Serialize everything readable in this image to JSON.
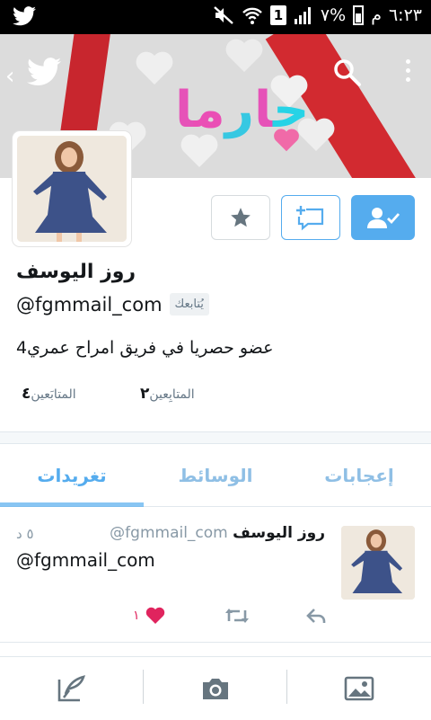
{
  "status_bar": {
    "time": "٦:٢٣",
    "period": "م",
    "battery": "٧%",
    "sim": "1"
  },
  "header": {
    "banner_text": [
      "ا",
      "م",
      "ر",
      "ا",
      "ح"
    ]
  },
  "profile": {
    "name": "روز اليوسف",
    "handle": "@fgmmail_com",
    "follows_you": "يُتابعك",
    "bio": "عضو حصريا في فريق امراح عمري4",
    "followers_label": "المتابَعين",
    "followers_count": "٤",
    "following_label": "المتابِعين",
    "following_count": "٢"
  },
  "tabs": {
    "tweets": "تغريدات",
    "media": "الوسائط",
    "likes": "إعجابات",
    "active": "tweets"
  },
  "tweet": {
    "name": "روز اليوسف",
    "handle": "@fgmmail_com",
    "time": "٥ د",
    "text": "@fgmmail_com",
    "like_count": "١"
  },
  "colors": {
    "accent": "#55acee",
    "like": "#e0245e"
  },
  "icons": {
    "app": "twitter-bird-icon",
    "back": "chevron-left-icon",
    "search": "search-icon",
    "menu": "overflow-menu-icon",
    "favorite": "star-icon",
    "message": "direct-message-icon",
    "follow": "following-check-icon",
    "compose": "compose-icon",
    "camera": "camera-icon",
    "gallery": "image-icon"
  }
}
